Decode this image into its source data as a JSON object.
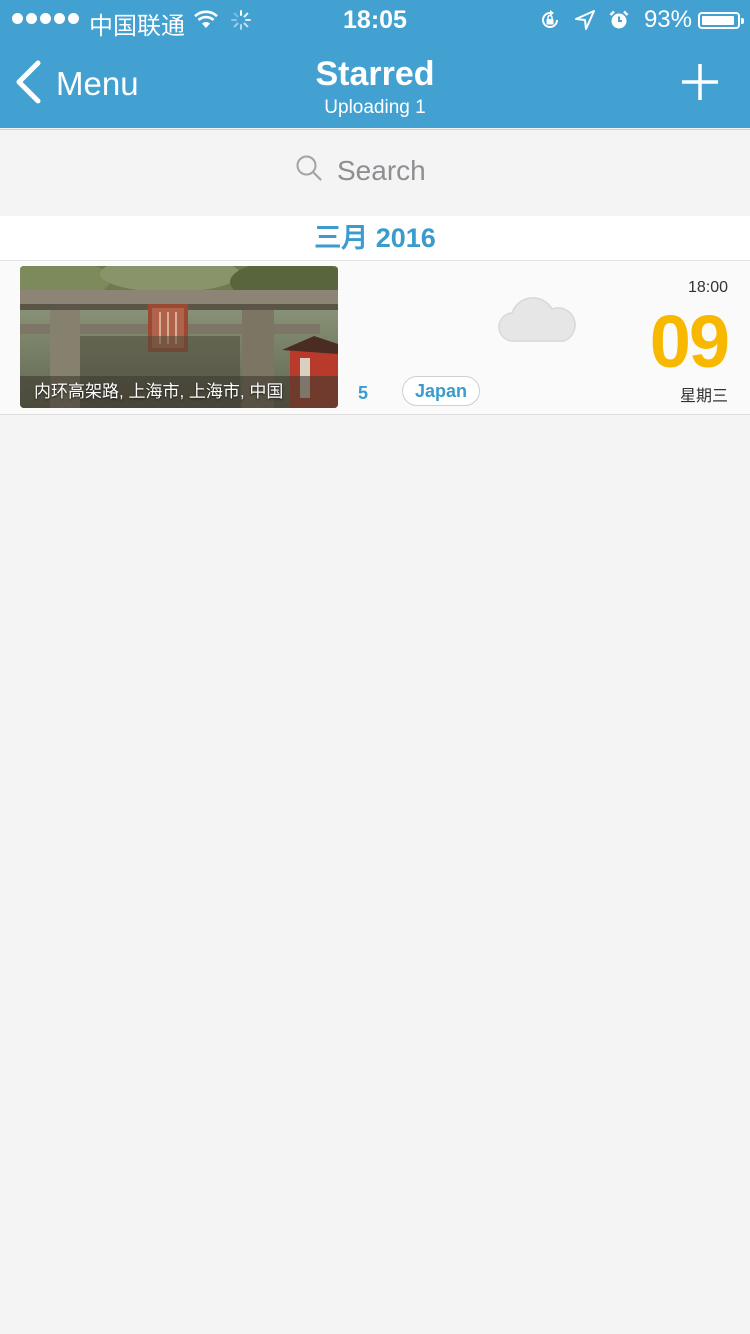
{
  "status_bar": {
    "carrier": "中国联通",
    "time": "18:05",
    "battery": "93%",
    "battery_level": 0.93
  },
  "nav": {
    "back_label": "Menu",
    "title": "Starred",
    "subtitle": "Uploading 1"
  },
  "search": {
    "placeholder": "Search"
  },
  "section": {
    "header": "三月 2016"
  },
  "entries": [
    {
      "location": "内环高架路, 上海市, 上海市, 中国",
      "count": "5",
      "tag": "Japan",
      "weather_icon": "cloud-icon",
      "time": "18:00",
      "day": "09",
      "weekday": "星期三"
    }
  ],
  "colors": {
    "header_bg": "#42a1d0",
    "accent_blue": "#3a9bcc",
    "day_yellow": "#f8b800",
    "background": "#f4f4f4"
  }
}
